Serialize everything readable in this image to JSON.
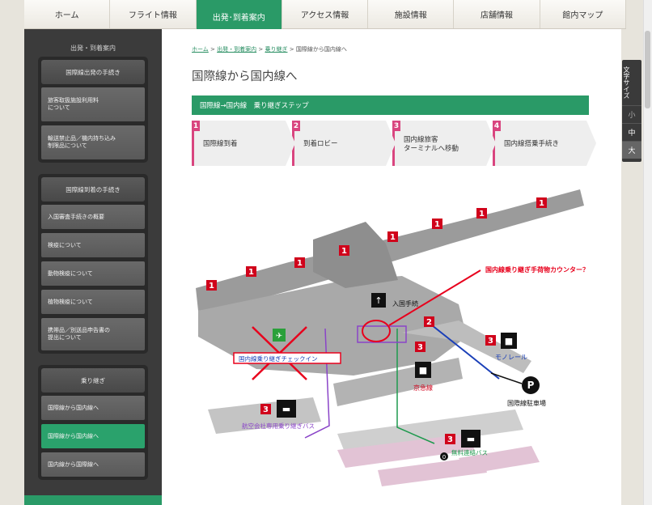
{
  "nav": {
    "tabs": [
      {
        "label": "ホーム"
      },
      {
        "label": "フライト情報"
      },
      {
        "label": "出発･到着案内"
      },
      {
        "label": "アクセス情報"
      },
      {
        "label": "施設情報"
      },
      {
        "label": "店舗情報"
      },
      {
        "label": "館内マップ"
      }
    ],
    "active_index": 2
  },
  "sidebar": {
    "heading": "出発・到着案内",
    "groups": [
      {
        "title": "国際線出発の手続き",
        "items": [
          "旅客取扱施設利用料\nについて",
          "輸送禁止品／機内持ち込み\n制限品について"
        ]
      },
      {
        "title": "国際線到着の手続き",
        "items": [
          "入国審査手続きの概要",
          "検疫について",
          "動物検疫について",
          "植物検疫について",
          "携帯品／別送品申告書の\n提出について"
        ]
      },
      {
        "title": "乗り継ぎ",
        "items": [
          "国際線から国内線へ",
          "国際線から国内線へ",
          "国内線から国際線へ"
        ],
        "active_index": 1
      }
    ]
  },
  "breadcrumb": {
    "home": "ホーム",
    "sep": ">",
    "level1": "出発・到着案内",
    "level2": "乗り継ぎ",
    "current": "国際線から国内線へ"
  },
  "page_title": "国際線から国内線へ",
  "section_title": "国際線→国内線　乗り継ぎステップ",
  "steps": [
    {
      "num": "1",
      "label": "国際線到着"
    },
    {
      "num": "2",
      "label": "到着ロビー"
    },
    {
      "num": "3",
      "label": "国内線旅客\nターミナルへ移動"
    },
    {
      "num": "4",
      "label": "国内線搭乗手続き"
    }
  ],
  "map": {
    "gate_marker": "1",
    "labels": {
      "annotation": "国内線乗り継ぎ手荷物カウンター？",
      "immigration": "入国手続",
      "transfer_checkin": "国内線乗り継ぎチェックイン",
      "monorail": "モノレール",
      "keikyu": "京急線",
      "parking": "国際線駐車場",
      "airline_bus": "航空会社専用乗り継ぎバス",
      "free_bus": "無料連絡バス",
      "num_2": "2",
      "num_3": "3",
      "num_0": "0",
      "parking_icon": "P"
    },
    "colors": {
      "marker": "#d0021b",
      "route_blue": "#1a3fb8",
      "route_purple": "#8a44c8",
      "route_green": "#1e9a4e",
      "annotation": "#e8001c"
    }
  },
  "font_size_widget": {
    "label": "文字サイズ",
    "options": [
      "小",
      "中",
      "大"
    ]
  },
  "icons": [
    "elevator-icon",
    "train-icon",
    "bus-icon",
    "parking-icon",
    "airplane-icon"
  ]
}
